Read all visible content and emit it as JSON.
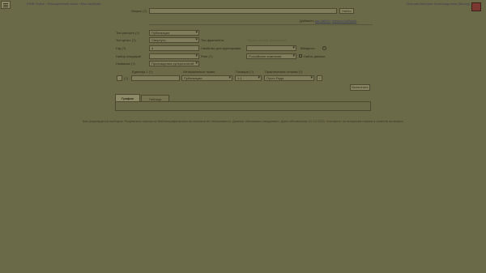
{
  "header": {
    "breadcrumb": "EDIB Online › Расширенный поиск › Мои выборки",
    "user": "Петрова Валерия Александровна (Выход)"
  },
  "search": {
    "label": "Запрос (?)",
    "value": "",
    "button": "Найти",
    "add_prefix": "Добавить",
    "link_help": "как найти?",
    "link_extra": "поиск в выборке"
  },
  "form": {
    "left": [
      {
        "label": "Тип рапорта (?)",
        "value": "Публикация"
      },
      {
        "label": "Тип цитат. (?)",
        "value": "Свернуть"
      },
      {
        "label": "Год (?)",
        "value": "4"
      },
      {
        "label": "Набор операций",
        "value": ""
      },
      {
        "label": "Название (?)",
        "value": "Прихождения суперпонятий"
      }
    ],
    "right": [
      {
        "label": "Тип фрагмента",
        "value": "Первое в ряду фрагмента"
      },
      {
        "label": "Свойство для группировки",
        "value": ""
      },
      {
        "label": "Ранг (?)",
        "value": "Российские компании"
      }
    ],
    "checkbox_a": "Вйэарить",
    "checkbox_b": "Найти данные"
  },
  "filter_row": {
    "headers": [
      "Единица 1 (?)",
      "Интервальные право",
      "Позиция (?)",
      "Практические отзывы (?)"
    ],
    "prefix": "(?)",
    "values": [
      "",
      "Публикации",
      "1-1",
      "Пусть Рада"
    ],
    "minus": "-",
    "plus": "+"
  },
  "apply_button": "Выполнить",
  "tabs": [
    "График",
    "Таблица"
  ],
  "footer": "Как формируется выборка: Результаты поиска из библиографических источников не обновляются. Данные обновлены ежедневно. Дата обновления: 22.12.2021. Контакты: по вопросам поиска и ответов на вопросы. Политика конфиденциальности. © EDIB"
}
